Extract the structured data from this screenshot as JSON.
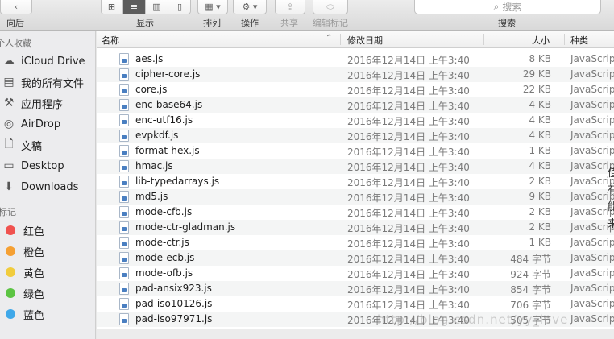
{
  "toolbar": {
    "back_label": "向后",
    "view_label": "显示",
    "sort_label": "排列",
    "action_label": "操作",
    "share_label": "共享",
    "tags_label": "编辑标记",
    "search_label": "搜索",
    "search_placeholder": "搜索"
  },
  "sidebar": {
    "favorites_header": "个人收藏",
    "favorites": [
      {
        "label": "iCloud Drive",
        "icon": "cloud-icon"
      },
      {
        "label": "我的所有文件",
        "icon": "all-files-icon"
      },
      {
        "label": "应用程序",
        "icon": "applications-icon"
      },
      {
        "label": "AirDrop",
        "icon": "airdrop-icon"
      },
      {
        "label": "文稿",
        "icon": "documents-icon"
      },
      {
        "label": "Desktop",
        "icon": "desktop-icon"
      },
      {
        "label": "Downloads",
        "icon": "downloads-icon"
      }
    ],
    "tags_header": "标记",
    "tags": [
      {
        "label": "红色",
        "color": "#f0524f"
      },
      {
        "label": "橙色",
        "color": "#f5a033"
      },
      {
        "label": "黄色",
        "color": "#f1cc3d"
      },
      {
        "label": "绿色",
        "color": "#5cc443"
      },
      {
        "label": "蓝色",
        "color": "#3fa8e9"
      }
    ]
  },
  "list": {
    "columns": {
      "name": "名称",
      "date": "修改日期",
      "size": "大小",
      "kind": "种类"
    },
    "files": [
      {
        "name": "aes.js",
        "date": "2016年12月14日 上午3:40",
        "size": "8 KB",
        "kind": "JavaScript"
      },
      {
        "name": "cipher-core.js",
        "date": "2016年12月14日 上午3:40",
        "size": "29 KB",
        "kind": "JavaScript"
      },
      {
        "name": "core.js",
        "date": "2016年12月14日 上午3:40",
        "size": "22 KB",
        "kind": "JavaScript"
      },
      {
        "name": "enc-base64.js",
        "date": "2016年12月14日 上午3:40",
        "size": "4 KB",
        "kind": "JavaScript"
      },
      {
        "name": "enc-utf16.js",
        "date": "2016年12月14日 上午3:40",
        "size": "4 KB",
        "kind": "JavaScript"
      },
      {
        "name": "evpkdf.js",
        "date": "2016年12月14日 上午3:40",
        "size": "4 KB",
        "kind": "JavaScript"
      },
      {
        "name": "format-hex.js",
        "date": "2016年12月14日 上午3:40",
        "size": "1 KB",
        "kind": "JavaScript"
      },
      {
        "name": "hmac.js",
        "date": "2016年12月14日 上午3:40",
        "size": "4 KB",
        "kind": "JavaScript"
      },
      {
        "name": "lib-typedarrays.js",
        "date": "2016年12月14日 上午3:40",
        "size": "2 KB",
        "kind": "JavaScript"
      },
      {
        "name": "md5.js",
        "date": "2016年12月14日 上午3:40",
        "size": "9 KB",
        "kind": "JavaScript"
      },
      {
        "name": "mode-cfb.js",
        "date": "2016年12月14日 上午3:40",
        "size": "2 KB",
        "kind": "JavaScript"
      },
      {
        "name": "mode-ctr-gladman.js",
        "date": "2016年12月14日 上午3:40",
        "size": "2 KB",
        "kind": "JavaScript"
      },
      {
        "name": "mode-ctr.js",
        "date": "2016年12月14日 上午3:40",
        "size": "1 KB",
        "kind": "JavaScript"
      },
      {
        "name": "mode-ecb.js",
        "date": "2016年12月14日 上午3:40",
        "size": "484 字节",
        "kind": "JavaScript"
      },
      {
        "name": "mode-ofb.js",
        "date": "2016年12月14日 上午3:40",
        "size": "924 字节",
        "kind": "JavaScript"
      },
      {
        "name": "pad-ansix923.js",
        "date": "2016年12月14日 上午3:40",
        "size": "854 字节",
        "kind": "JavaScript"
      },
      {
        "name": "pad-iso10126.js",
        "date": "2016年12月14日 上午3:40",
        "size": "706 字节",
        "kind": "JavaScript"
      },
      {
        "name": "pad-iso97971.js",
        "date": "2016年12月14日 上午3:40",
        "size": "505 字节",
        "kind": "JavaScript"
      }
    ]
  },
  "watermark": "http://blog.csdn.net/yy_love",
  "backdrop_chars": [
    "值",
    "有",
    "能",
    "来"
  ]
}
